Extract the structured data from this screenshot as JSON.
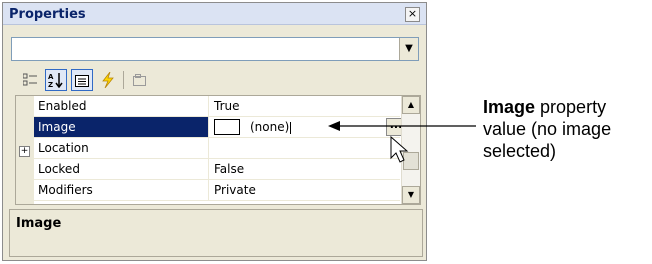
{
  "window": {
    "title": "Properties",
    "close_glyph": "×"
  },
  "object_selector": {
    "value": ""
  },
  "toolbar": {
    "buttons": [
      {
        "name": "categorized",
        "icon": "categorized-icon",
        "active": false
      },
      {
        "name": "alphabetical",
        "icon": "alphabetical-sort-icon",
        "active": true
      },
      {
        "name": "properties",
        "icon": "properties-icon",
        "active": true
      },
      {
        "name": "events",
        "icon": "lightning-icon",
        "active": false
      },
      {
        "name": "property-pages",
        "icon": "property-pages-icon",
        "active": false
      }
    ]
  },
  "properties": [
    {
      "name": "Enabled",
      "value": "True"
    },
    {
      "name": "Image",
      "value": "(none)",
      "selected": true
    },
    {
      "name": "Location",
      "value": "",
      "expandable": true,
      "expand_glyph": "+"
    },
    {
      "name": "Locked",
      "value": "False"
    },
    {
      "name": "Modifiers",
      "value": "Private"
    }
  ],
  "ellipsis_label": "...",
  "description": {
    "title": "Image"
  },
  "callout": {
    "bold": "Image",
    "rest": " property value (no image selected)"
  },
  "colors": {
    "selection": "#0a246a",
    "panel": "#ece9d8",
    "title_text": "#0a246a"
  }
}
